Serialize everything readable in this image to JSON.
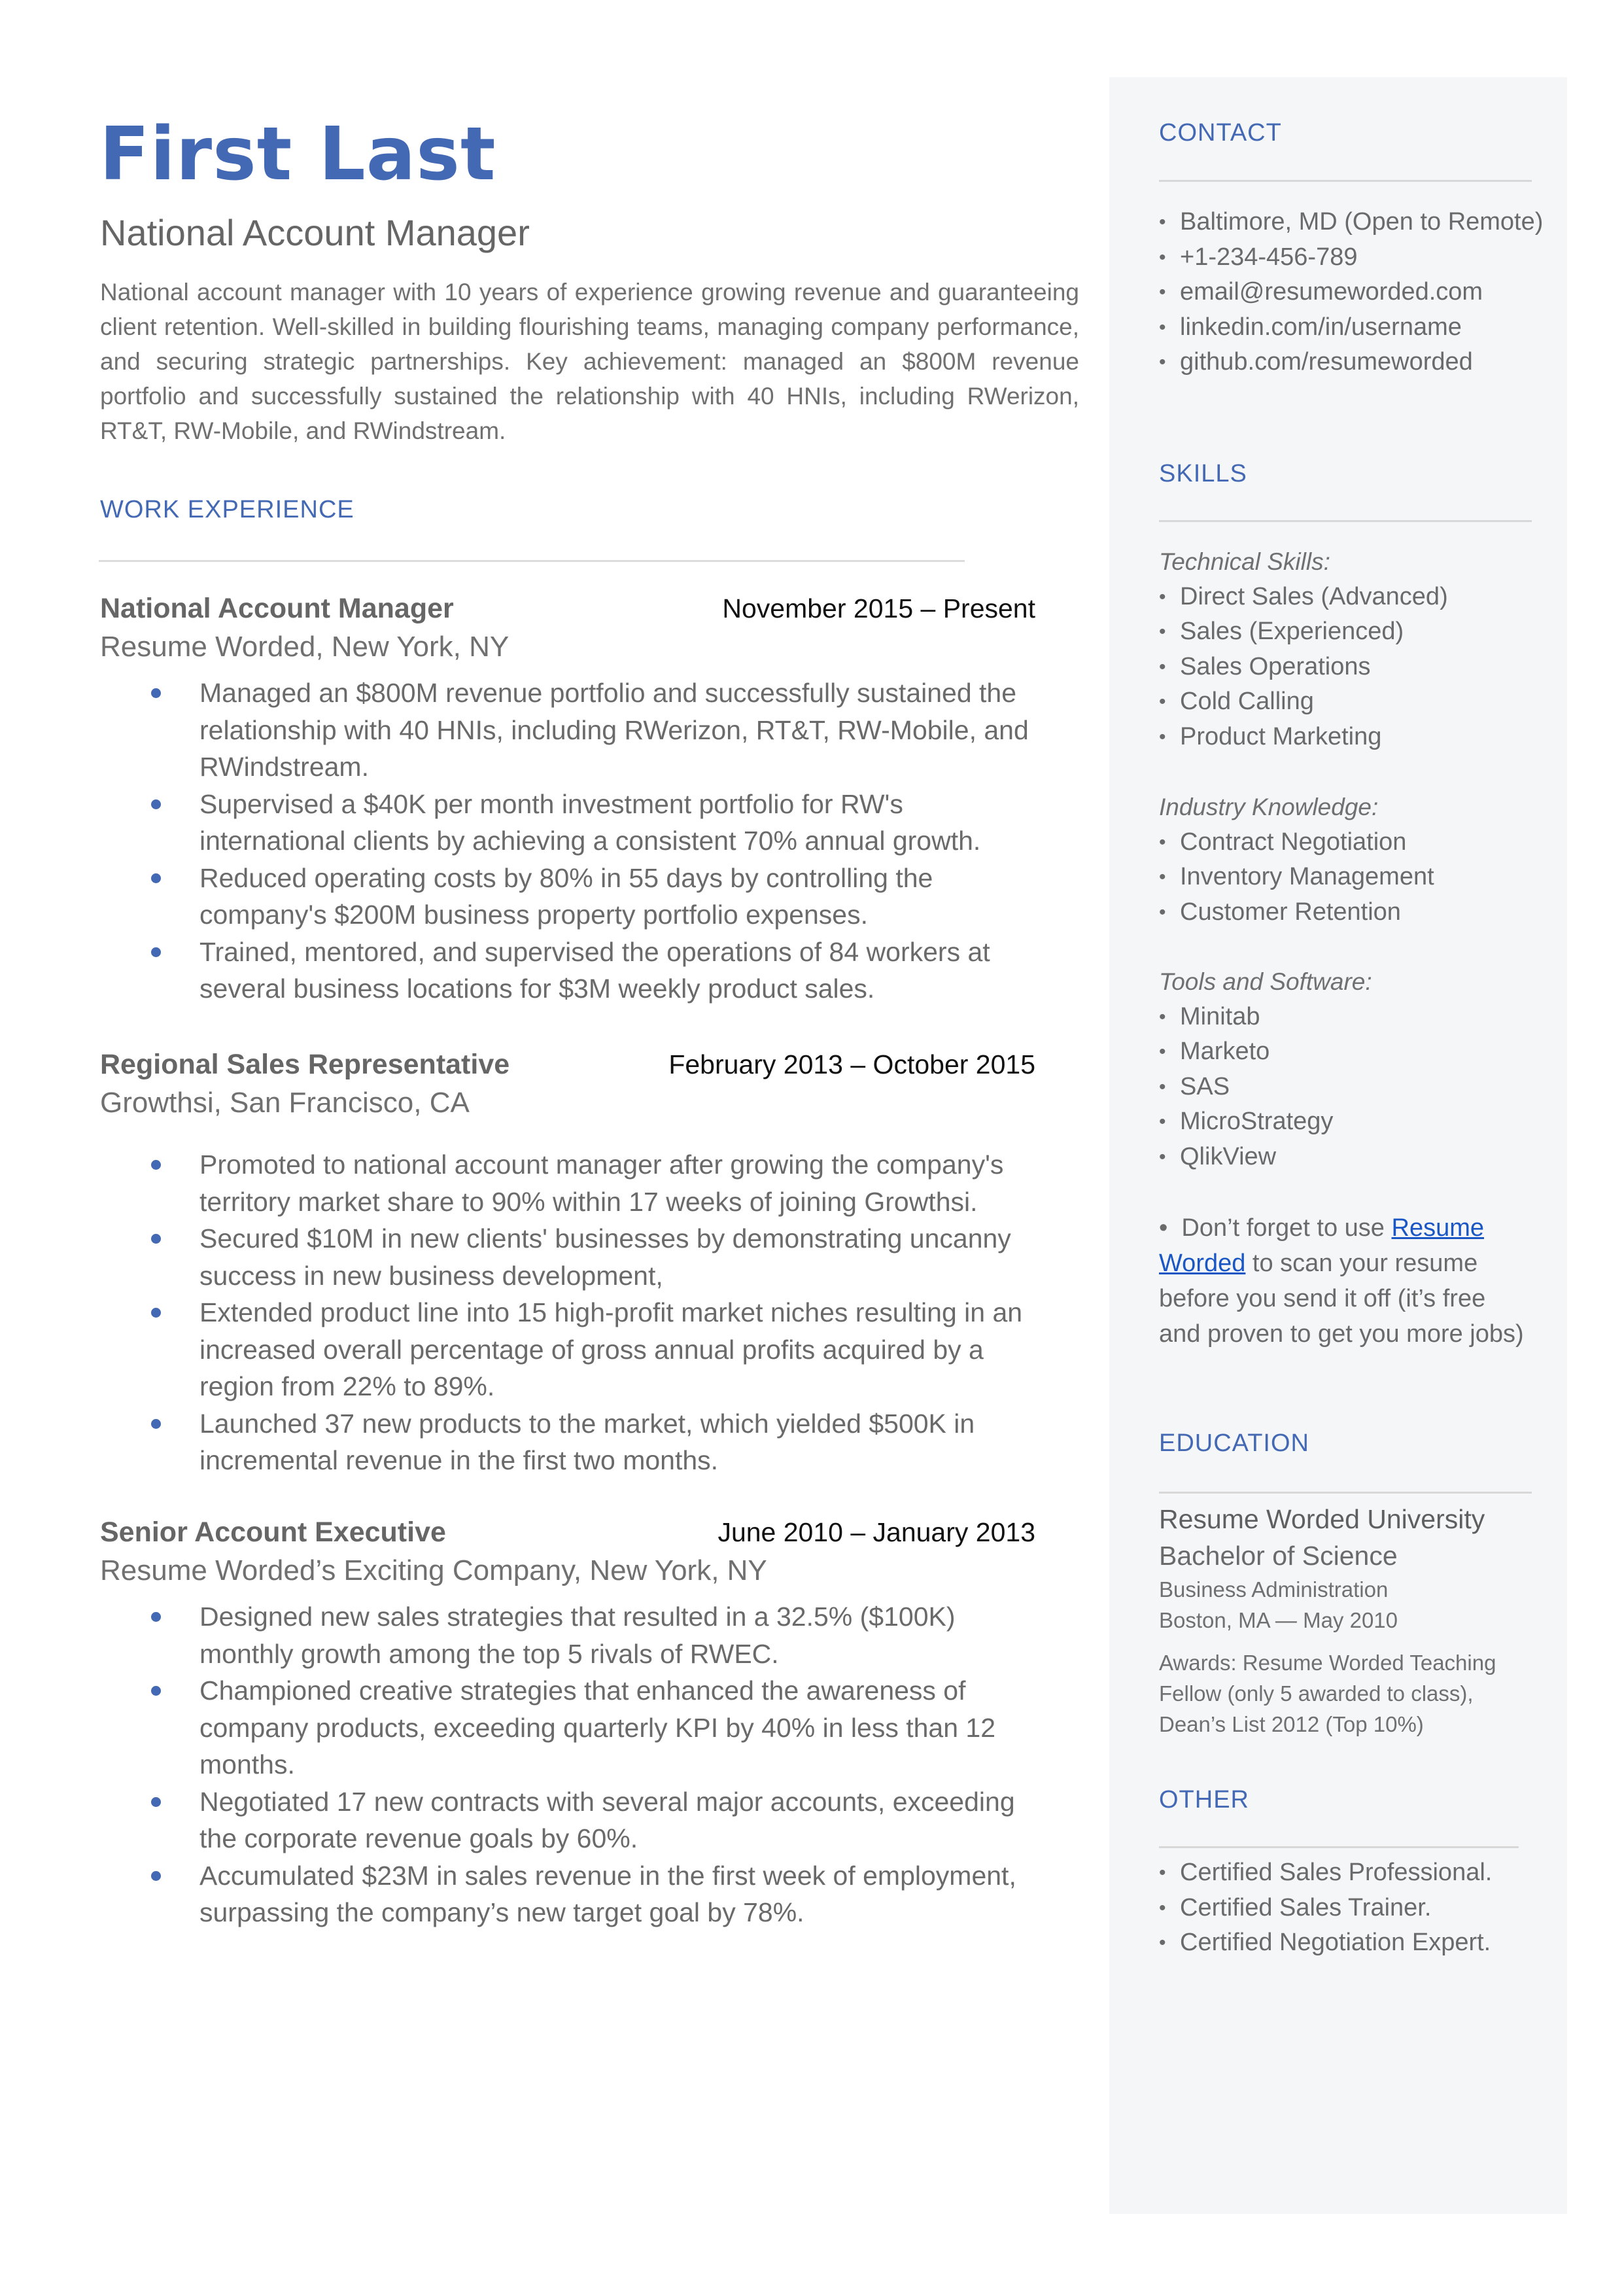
{
  "header": {
    "name": "First Last",
    "headline": "National Account Manager",
    "summary": "National account manager with 10 years of experience growing revenue and guaranteeing client retention. Well-skilled in building flourishing teams, managing company performance, and securing strategic partnerships. Key achievement: managed an $800M revenue portfolio and successfully sustained the relationship with 40 HNIs, including RWerizon, RT&T, RW-Mobile, and RWindstream."
  },
  "colors": {
    "accent": "#4469B4",
    "sidebar_bg": "#F5F6F8",
    "link": "#1A56C4",
    "body_text": "#666666"
  },
  "work": {
    "title": "WORK EXPERIENCE",
    "jobs": [
      {
        "title": "National Account Manager",
        "dates": "November 2015 – Present",
        "company": "Resume Worded, New York, NY",
        "bullets": [
          "Managed an $800M revenue portfolio and successfully sustained the relationship with 40 HNIs, including RWerizon, RT&T, RW-Mobile, and RWindstream.",
          "Supervised a $40K per month investment portfolio for RW's international clients by achieving a consistent 70% annual growth.",
          "Reduced operating costs by 80% in 55 days by controlling the company's $200M business property portfolio expenses.",
          "Trained, mentored, and supervised the operations of 84 workers at several business locations for $3M weekly product sales."
        ]
      },
      {
        "title": "Regional Sales Representative",
        "dates": "February 2013 – October 2015",
        "company": "Growthsi, San Francisco, CA",
        "bullets": [
          "Promoted to national account manager after growing the company's territory market share to 90% within 17 weeks of joining Growthsi.",
          "Secured $10M in new clients' businesses by demonstrating uncanny success in new business development,",
          "Extended product line into 15 high-profit market niches resulting in an increased overall percentage of gross annual profits acquired by a region from 22% to 89%.",
          "Launched 37 new products to the market, which yielded $500K in incremental revenue in the first two months."
        ]
      },
      {
        "title": "Senior Account Executive",
        "dates": "June 2010 – January 2013",
        "company": "Resume Worded’s Exciting Company, New York, NY",
        "bullets": [
          "Designed new sales strategies that resulted in a 32.5% ($100K) monthly growth among the top 5 rivals of RWEC.",
          "Championed creative strategies that enhanced the awareness of company products, exceeding quarterly KPI by 40% in less than 12 months.",
          "Negotiated 17 new contracts with several major accounts, exceeding the corporate revenue goals by 60%.",
          "Accumulated $23M in sales revenue in the first week of employment, surpassing the company’s new target goal by 78%."
        ]
      }
    ]
  },
  "sidebar": {
    "contact": {
      "title": "CONTACT",
      "items": [
        " Baltimore, MD (Open to Remote)",
        "+1-234-456-789",
        "email@resumeworded.com",
        "linkedin.com/in/username",
        "github.com/resumeworded"
      ]
    },
    "skills": {
      "title": "SKILLS",
      "groups": [
        {
          "label": "Technical Skills:",
          "items": [
            "Direct Sales (Advanced)",
            "Sales (Experienced)",
            "Sales Operations",
            "Cold Calling",
            "Product Marketing"
          ]
        },
        {
          "label": "Industry Knowledge:",
          "items": [
            "Contract Negotiation",
            "Inventory Management",
            "Customer Retention"
          ]
        },
        {
          "label": "Tools and Software:",
          "items": [
            "Minitab",
            "Marketo",
            "SAS",
            "MicroStrategy",
            "QlikView"
          ]
        }
      ],
      "tip": {
        "prefix": "Don’t forget to use ",
        "link": "Resume Worded",
        "suffix": " to scan your resume before you send it off (it’s free and proven to get you more jobs)"
      }
    },
    "education": {
      "title": "EDUCATION",
      "school": "Resume Worded University",
      "degree": "Bachelor of Science",
      "field": "Business Administration",
      "location_date": "Boston, MA — May 2010",
      "awards": "Awards: Resume Worded Teaching Fellow (only 5 awarded to class), Dean’s List 2012 (Top 10%)"
    },
    "other": {
      "title": "OTHER",
      "items": [
        "Certified Sales Professional.",
        "Certified Sales Trainer.",
        "Certified Negotiation Expert."
      ]
    }
  }
}
